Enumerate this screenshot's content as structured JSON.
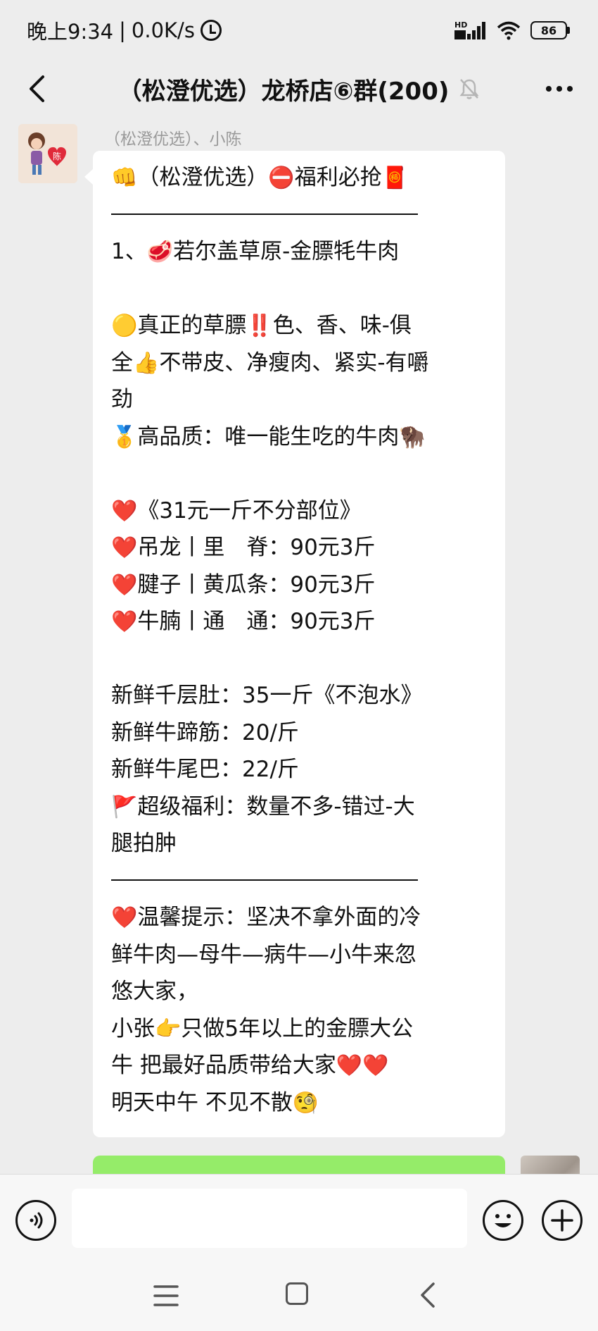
{
  "status_bar": {
    "time": "晚上9:34",
    "separator": "|",
    "network_speed": "0.0K/s",
    "signal_label": "HD",
    "battery": "86"
  },
  "header": {
    "title": "（松澄优选）龙桥店⑥群(200)"
  },
  "message": {
    "sender": "（松澄优选）、小陈",
    "avatar_text": "陈",
    "lines": [
      {
        "emoji_pre": "👊",
        "text": "（松澄优选）",
        "emoji_mid": "⛔",
        "text2": "福利必抢",
        "emoji_post": "🧧"
      },
      {
        "divider": true
      },
      {
        "text": "1、",
        "emoji_mid": "🥩",
        "text2": "若尔盖草原-金膘牦牛肉"
      },
      {
        "blank": true
      },
      {
        "emoji_pre": "🟡",
        "text": "真正的草膘",
        "emoji_mid": "‼️",
        "text2": "色、香、味-俱"
      },
      {
        "text": "全",
        "emoji_mid": "👍",
        "text2": "不带皮、净瘦肉、紧实-有嚼"
      },
      {
        "text": "劲"
      },
      {
        "emoji_pre": "🥇",
        "text": "高品质：唯一能生吃的牛肉",
        "emoji_post": "🦬"
      },
      {
        "blank": true
      },
      {
        "emoji_pre": "❤️",
        "text": "《31元一斤不分部位》"
      },
      {
        "emoji_pre": "❤️",
        "text": "吊龙丨里　脊：90元3斤"
      },
      {
        "emoji_pre": "❤️",
        "text": "腱子丨黄瓜条：90元3斤"
      },
      {
        "emoji_pre": "❤️",
        "text": "牛腩丨通　通：90元3斤"
      },
      {
        "blank": true
      },
      {
        "text": "新鲜千层肚：35一斤《不泡水》"
      },
      {
        "text": "新鲜牛蹄筋：20/斤"
      },
      {
        "text": "新鲜牛尾巴：22/斤"
      },
      {
        "emoji_pre": "🚩",
        "text": "超级福利：数量不多-错过-大"
      },
      {
        "text": "腿拍肿"
      },
      {
        "divider": true
      },
      {
        "emoji_pre": "❤️",
        "text": "温馨提示：坚决不拿外面的冷"
      },
      {
        "text": "鲜牛肉—母牛—病牛—小牛来忽"
      },
      {
        "text": "悠大家，"
      },
      {
        "text": " 小张",
        "emoji_mid": "👉",
        "text2": "只做5年以上的金膘大公"
      },
      {
        "text": "牛  把最好品质带给大家",
        "emoji_post": "❤️❤️"
      },
      {
        "text": "明天中午  不见不散",
        "emoji_post": "🧐"
      }
    ]
  },
  "input": {
    "value": "",
    "placeholder": ""
  },
  "colors": {
    "background": "#ededed",
    "bubble": "#ffffff",
    "own_bubble": "#95ec69",
    "sender_name": "#9a9a9a"
  },
  "icons": [
    "back-arrow-icon",
    "mute-bell-icon",
    "more-icon",
    "voice-icon",
    "emoji-icon",
    "plus-icon",
    "menu-icon",
    "home-icon",
    "nav-back-icon"
  ]
}
